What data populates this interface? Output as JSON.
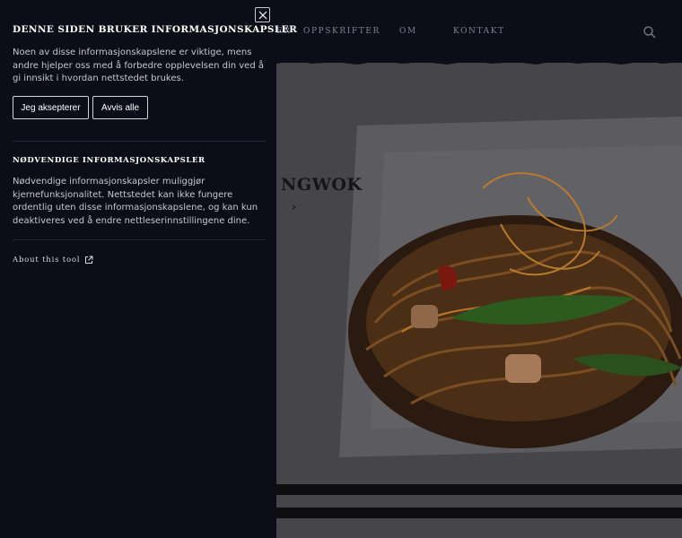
{
  "nav": {
    "items": [
      "ER",
      "OPPSKRIFTER",
      "OM",
      "KONTAKT"
    ]
  },
  "hero": {
    "title": "NGWOK",
    "arrow": "›"
  },
  "cookie_panel": {
    "heading": "Denne siden bruker informasjonskapsler",
    "intro": "Noen av disse informasjonskapslene er viktige, mens andre hjelper oss med å forbedre opplevelsen din ved å gi innsikt i hvordan nettstedet brukes.",
    "accept_label": "Jeg aksepterer",
    "reject_label": "Avvis alle",
    "necessary_heading": "Nødvendige informasjonskapsler",
    "necessary_text": "Nødvendige informasjonskapsler muliggjør kjernefunksjonalitet. Nettstedet kan ikke fungere ordentlig uten disse informasjonskapslene, og kan kun deaktiveres ved å endre nettleserinnstillingene dine.",
    "about_label": "About this tool"
  },
  "icons": {
    "close": "close-icon",
    "search": "search-icon",
    "external": "external-link-icon"
  },
  "colors": {
    "panel_bg": "#0c0e17",
    "text": "#c5c7cf",
    "heading": "#ffffff"
  }
}
